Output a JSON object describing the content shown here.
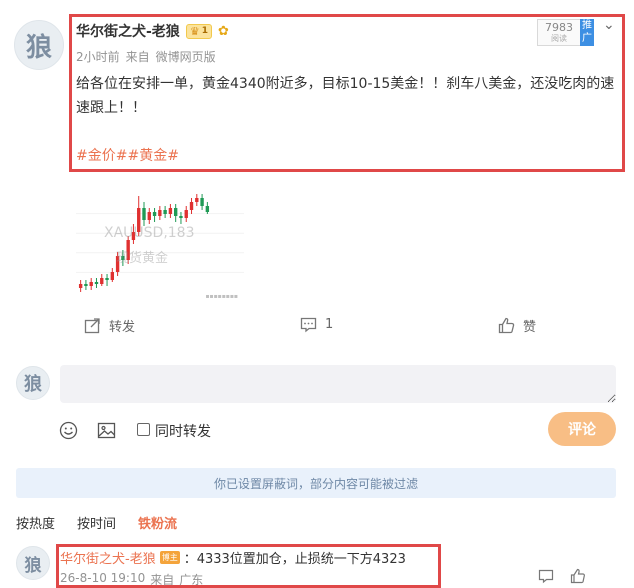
{
  "post": {
    "avatar_text": "狼",
    "author": "华尔街之犬-老狼",
    "crown_level": "1",
    "time": "2小时前",
    "source_prefix": "来自",
    "source": "微博网页版",
    "read_count": "7983",
    "read_label": "阅读",
    "promote_label": "推广",
    "body": "给各位在安排一单，黄金4340附近多，目标10-15美金！！刹车八美金，还没吃肉的速速跟上！！",
    "hashtags": [
      "#金价#",
      "#黄金#"
    ],
    "chart_overlay_1": "XAUUSD,183",
    "chart_overlay_2": "现货黄金"
  },
  "chart_data": {
    "type": "candlestick",
    "title": "",
    "xlabel": "",
    "ylabel": "",
    "candles": [
      {
        "o": 4302,
        "c": 4304,
        "h": 4306,
        "l": 4300
      },
      {
        "o": 4304,
        "c": 4303,
        "h": 4306,
        "l": 4301
      },
      {
        "o": 4303,
        "c": 4305,
        "h": 4307,
        "l": 4301
      },
      {
        "o": 4305,
        "c": 4304,
        "h": 4307,
        "l": 4302
      },
      {
        "o": 4304,
        "c": 4307,
        "h": 4309,
        "l": 4303
      },
      {
        "o": 4307,
        "c": 4306,
        "h": 4309,
        "l": 4303
      },
      {
        "o": 4306,
        "c": 4310,
        "h": 4312,
        "l": 4305
      },
      {
        "o": 4310,
        "c": 4318,
        "h": 4320,
        "l": 4308
      },
      {
        "o": 4318,
        "c": 4316,
        "h": 4321,
        "l": 4313
      },
      {
        "o": 4316,
        "c": 4326,
        "h": 4328,
        "l": 4314
      },
      {
        "o": 4326,
        "c": 4330,
        "h": 4334,
        "l": 4324
      },
      {
        "o": 4330,
        "c": 4342,
        "h": 4348,
        "l": 4328
      },
      {
        "o": 4342,
        "c": 4336,
        "h": 4345,
        "l": 4333
      },
      {
        "o": 4336,
        "c": 4340,
        "h": 4342,
        "l": 4334
      },
      {
        "o": 4340,
        "c": 4338,
        "h": 4342,
        "l": 4335
      },
      {
        "o": 4338,
        "c": 4341,
        "h": 4343,
        "l": 4336
      },
      {
        "o": 4341,
        "c": 4339,
        "h": 4343,
        "l": 4337
      },
      {
        "o": 4339,
        "c": 4342,
        "h": 4344,
        "l": 4337
      },
      {
        "o": 4342,
        "c": 4338,
        "h": 4344,
        "l": 4335
      },
      {
        "o": 4338,
        "c": 4337,
        "h": 4340,
        "l": 4334
      },
      {
        "o": 4337,
        "c": 4341,
        "h": 4343,
        "l": 4335
      },
      {
        "o": 4341,
        "c": 4345,
        "h": 4347,
        "l": 4339
      },
      {
        "o": 4345,
        "c": 4347,
        "h": 4349,
        "l": 4343
      },
      {
        "o": 4347,
        "c": 4343,
        "h": 4349,
        "l": 4341
      },
      {
        "o": 4343,
        "c": 4340,
        "h": 4345,
        "l": 4339
      }
    ],
    "colors": {
      "up": "#e03030",
      "down": "#1f9a55"
    }
  },
  "actions": {
    "share_label": "转发",
    "comment_count": "1",
    "like_label": "赞"
  },
  "composer": {
    "avatar_text": "狼",
    "repost_label": "同时转发",
    "submit_label": "评论"
  },
  "notice": "你已设置屏蔽词，部分内容可能被过滤",
  "sort_tabs": [
    "按热度",
    "按时间",
    "铁粉流"
  ],
  "comment": {
    "avatar_text": "狼",
    "author": "华尔街之犬-老狼",
    "badge": "博主",
    "text": "：4333位置加仓，止损统一下方4323",
    "time": "26-8-10 19:10",
    "source_prefix": "来自",
    "location": "广东"
  },
  "colors": {
    "accent": "#eb7350",
    "highlight_border": "#e04848",
    "submit_button": "#f8be85",
    "notice_bg": "#e9f1fb"
  }
}
